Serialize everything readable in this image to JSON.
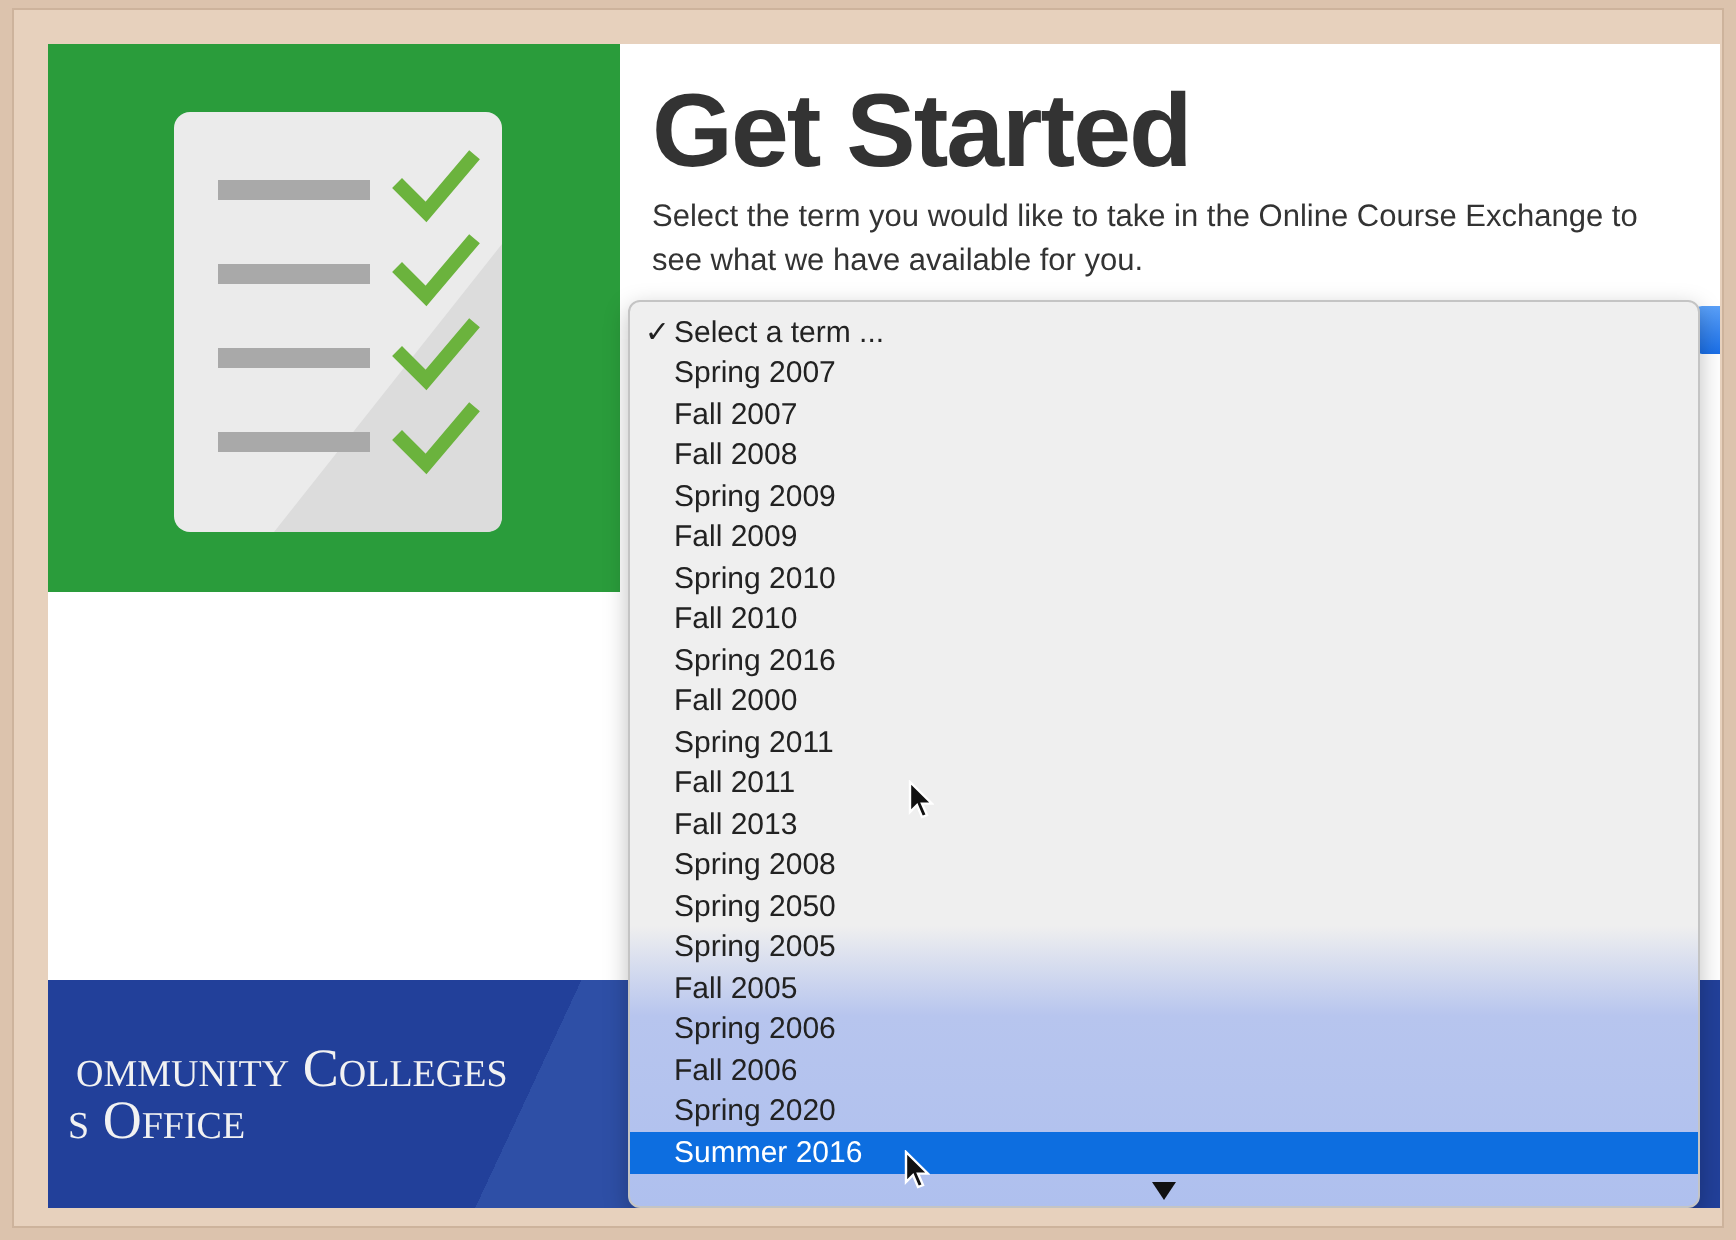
{
  "heading": "Get Started",
  "intro": "Select the term you would like to take in the Online Course Exchange to see what we have available for you.",
  "banner": {
    "lines": [
      "ommunity Colleges",
      "s Office"
    ]
  },
  "term_menu": {
    "check_glyph": "✓",
    "items": [
      {
        "label": "Select a term ...",
        "checked": true,
        "highlighted": false
      },
      {
        "label": "Spring 2007",
        "checked": false,
        "highlighted": false
      },
      {
        "label": "Fall 2007",
        "checked": false,
        "highlighted": false
      },
      {
        "label": "Fall 2008",
        "checked": false,
        "highlighted": false
      },
      {
        "label": "Spring 2009",
        "checked": false,
        "highlighted": false
      },
      {
        "label": "Fall 2009",
        "checked": false,
        "highlighted": false
      },
      {
        "label": "Spring 2010",
        "checked": false,
        "highlighted": false
      },
      {
        "label": "Fall 2010",
        "checked": false,
        "highlighted": false
      },
      {
        "label": "Spring 2016",
        "checked": false,
        "highlighted": false
      },
      {
        "label": "Fall 2000",
        "checked": false,
        "highlighted": false
      },
      {
        "label": "Spring 2011",
        "checked": false,
        "highlighted": false
      },
      {
        "label": "Fall 2011",
        "checked": false,
        "highlighted": false
      },
      {
        "label": "Fall 2013",
        "checked": false,
        "highlighted": false
      },
      {
        "label": "Spring 2008",
        "checked": false,
        "highlighted": false
      },
      {
        "label": "Spring 2050",
        "checked": false,
        "highlighted": false
      },
      {
        "label": "Spring 2005",
        "checked": false,
        "highlighted": false
      },
      {
        "label": "Fall 2005",
        "checked": false,
        "highlighted": false
      },
      {
        "label": "Spring 2006",
        "checked": false,
        "highlighted": false
      },
      {
        "label": "Fall 2006",
        "checked": false,
        "highlighted": false
      },
      {
        "label": "Spring 2020",
        "checked": false,
        "highlighted": false
      },
      {
        "label": "Summer 2016",
        "checked": false,
        "highlighted": true
      }
    ],
    "more_below": true
  }
}
